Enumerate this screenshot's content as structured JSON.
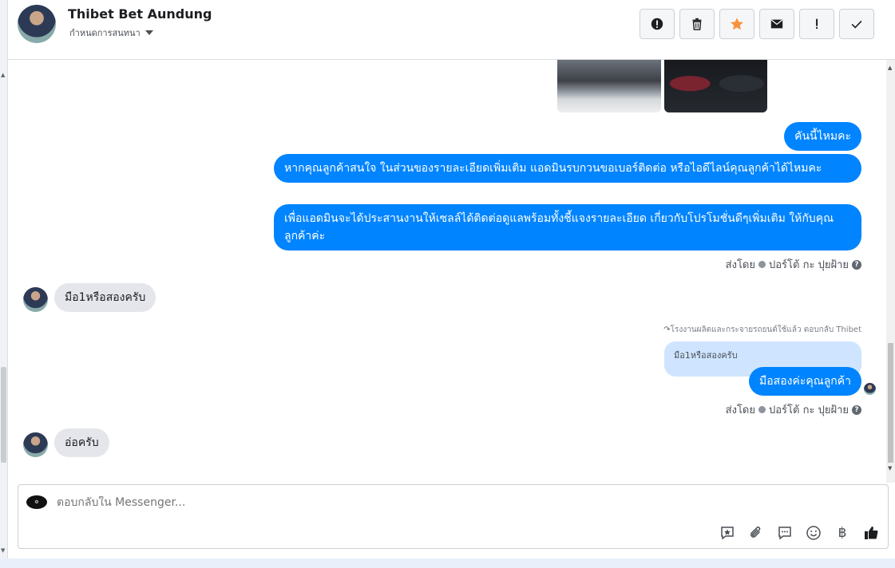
{
  "header": {
    "name": "Thibet Bet Aundung",
    "subtitle": "กำหนดการสนทนา",
    "actions": [
      {
        "icon": "alert-circle-icon",
        "label": "report"
      },
      {
        "icon": "trash-icon",
        "label": "delete"
      },
      {
        "icon": "star-icon",
        "label": "star"
      },
      {
        "icon": "envelope-icon",
        "label": "mark unread"
      },
      {
        "icon": "exclamation-icon",
        "label": "follow up"
      },
      {
        "icon": "checkmark-icon",
        "label": "done"
      }
    ],
    "star_color": "#f7923b"
  },
  "messages": [
    {
      "direction": "out",
      "text": "คันนี้ไหมคะ"
    },
    {
      "direction": "out",
      "text": "หากคุณลูกค้าสนใจ ในส่วนของรายละเอียดเพิ่มเติม แอดมินรบกวนขอเบอร์ติดต่อ หรือไอดีไลน์คุณลูกค้าได้ไหมคะ"
    },
    {
      "direction": "out",
      "text": "เพื่อแอดมินจะได้ประสานงานให้เซลล์ได้ติดต่อดูแลพร้อมทั้งชี้แจงรายละเอียด เกี่ยวกับโปรโมชั่นดีๆเพิ่มเติม ให้กับคุณลูกค้าค่ะ"
    },
    {
      "direction": "in",
      "text": "มือ1หรือสองครับ"
    },
    {
      "direction": "out",
      "text": "มือสองค่ะคุณลูกค้า"
    },
    {
      "direction": "in",
      "text": "อ่อครับ"
    }
  ],
  "sent_by": {
    "prefix": "ส่งโดย",
    "agent": "ปอร์โต้ กะ ปุยฝ้าย"
  },
  "reply": {
    "note": "โรงงานผลิตและกระจายรถยนต์ใช้แล้ว ตอบกลับ Thibet",
    "quoted": "มือ1หรือสองครับ"
  },
  "composer": {
    "placeholder": "ตอบกลับใน Messenger...",
    "tools": [
      "saved-reply-icon",
      "attachment-icon",
      "chat-bubble-icon",
      "emoji-icon",
      "baht-icon",
      "thumbs-up-icon"
    ]
  },
  "colors": {
    "outgoing": "#0084ff",
    "incoming": "#e4e6eb",
    "quoted": "#cfe5ff"
  }
}
